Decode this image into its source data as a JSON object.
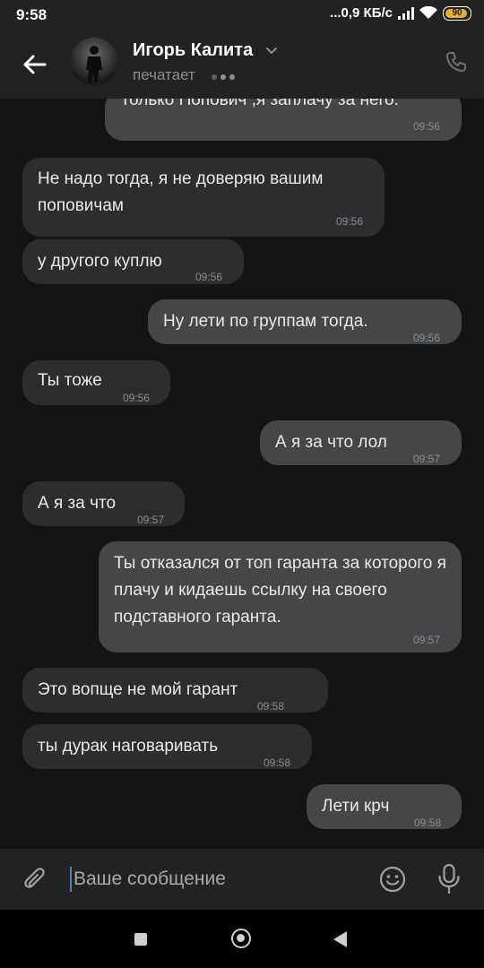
{
  "status_bar": {
    "time": "9:58",
    "network": "...0,9 КБ/с",
    "battery": "90"
  },
  "header": {
    "contact_name": "Игорь Калита",
    "status": "печатает"
  },
  "messages": [
    {
      "dir": "out",
      "text": "Только Попович ,я заплачу за него.",
      "time": "09:56"
    },
    {
      "dir": "in",
      "text": "Не надо тогда, я не доверяю вашим поповичам",
      "time": "09:56"
    },
    {
      "dir": "in",
      "text": "у другого куплю",
      "time": "09:56"
    },
    {
      "dir": "out",
      "text": "Ну лети по группам тогда.",
      "time": "09:56"
    },
    {
      "dir": "in",
      "text": "Ты тоже",
      "time": "09:56"
    },
    {
      "dir": "out",
      "text": "А я за что лол",
      "time": "09:57"
    },
    {
      "dir": "in",
      "text": "А я за что",
      "time": "09:57"
    },
    {
      "dir": "out",
      "text": "Ты отказался от топ гаранта за которого я плачу и кидаешь ссылку на своего подставного гаранта.",
      "time": "09:57"
    },
    {
      "dir": "in",
      "text": "Это вопще не мой гарант",
      "time": "09:58"
    },
    {
      "dir": "in",
      "text": "ты дурак наговаривать",
      "time": "09:58"
    },
    {
      "dir": "out",
      "text": "Лети крч",
      "time": "09:58"
    }
  ],
  "composer": {
    "placeholder": "Ваше сообщение"
  },
  "colors": {
    "background": "#141414",
    "incoming_bubble": "#2c2d2e",
    "outgoing_bubble": "#454647",
    "accent": "#5181b8"
  },
  "icons": [
    "back-arrow-icon",
    "chevron-down-icon",
    "phone-icon",
    "paperclip-icon",
    "emoji-icon",
    "microphone-icon"
  ]
}
